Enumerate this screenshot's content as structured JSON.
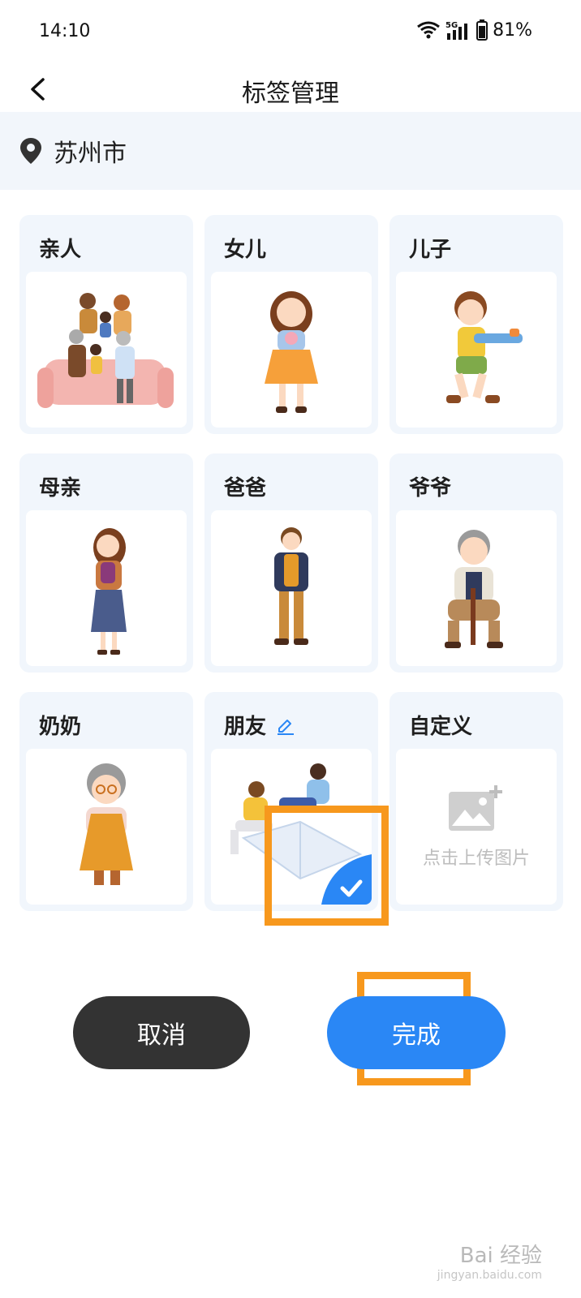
{
  "status_bar": {
    "time": "14:10",
    "battery": "81%",
    "network": "5G"
  },
  "nav": {
    "title": "标签管理"
  },
  "location": {
    "city": "苏州市"
  },
  "tags": [
    {
      "label": "亲人",
      "illustration": "family-illustration"
    },
    {
      "label": "女儿",
      "illustration": "daughter-illustration"
    },
    {
      "label": "儿子",
      "illustration": "son-illustration"
    },
    {
      "label": "母亲",
      "illustration": "mother-illustration"
    },
    {
      "label": "爸爸",
      "illustration": "father-illustration"
    },
    {
      "label": "爷爷",
      "illustration": "grandpa-illustration"
    },
    {
      "label": "奶奶",
      "illustration": "grandma-illustration"
    },
    {
      "label": "朋友",
      "illustration": "friends-illustration",
      "selected": true,
      "editable": true
    },
    {
      "label": "自定义",
      "upload_text": "点击上传图片"
    }
  ],
  "actions": {
    "cancel": "取消",
    "done": "完成"
  },
  "watermark": {
    "text": "Bai 经验",
    "sub": "jingyan.baidu.com"
  },
  "colors": {
    "accent": "#2a87f5",
    "highlight": "#f7981d",
    "dark_button": "#333333",
    "card_bg": "#f1f6fc"
  }
}
